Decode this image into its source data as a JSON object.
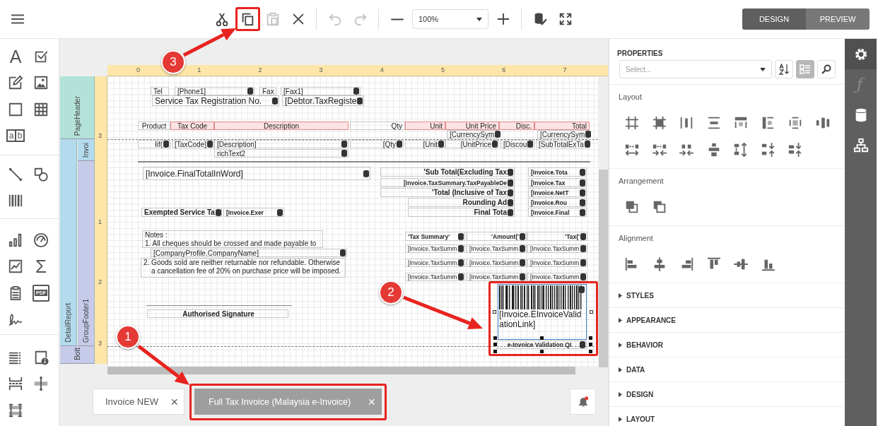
{
  "toolbar": {
    "tools": [
      {
        "kind": "cut",
        "disabled": false
      },
      {
        "kind": "copy",
        "disabled": false
      },
      {
        "kind": "paste",
        "disabled": true
      },
      {
        "kind": "delete",
        "disabled": false
      },
      {
        "kind": "undo",
        "disabled": true
      },
      {
        "kind": "redo",
        "disabled": true
      },
      {
        "kind": "zoom-out",
        "disabled": false
      },
      {
        "kind": "zoom-field",
        "value": "100%"
      },
      {
        "kind": "zoom-in",
        "disabled": false
      },
      {
        "kind": "validate",
        "disabled": false
      },
      {
        "kind": "fullscreen",
        "disabled": false
      }
    ],
    "modes": [
      {
        "label": "DESIGN",
        "selected": true
      },
      {
        "label": "PREVIEW",
        "selected": false
      }
    ]
  },
  "toolbox": [
    [
      {
        "kind": "label",
        "glyph": "A"
      },
      {
        "kind": "checkbox"
      },
      {
        "kind": "edit"
      },
      {
        "kind": "picture"
      },
      {
        "kind": "panel"
      },
      {
        "kind": "table"
      },
      {
        "kind": "character-comb",
        "glyphs": [
          "a",
          "b"
        ]
      }
    ],
    [
      {
        "kind": "line"
      },
      {
        "kind": "shape"
      },
      {
        "kind": "barcode"
      }
    ],
    [
      {
        "kind": "chart"
      },
      {
        "kind": "gauge"
      },
      {
        "kind": "sparkline"
      },
      {
        "kind": "summary",
        "glyph": "Σ"
      },
      {
        "kind": "clipboard"
      },
      {
        "kind": "pdf",
        "glyph": "PDF"
      },
      {
        "kind": "signature"
      }
    ],
    [
      {
        "kind": "toc"
      },
      {
        "kind": "page-info"
      },
      {
        "kind": "page-break"
      },
      {
        "kind": "cross-band-line"
      },
      {
        "kind": "cross-band-box"
      }
    ]
  ],
  "report": {
    "ruler": [
      "0",
      "1",
      "2",
      "3",
      "4",
      "5",
      "6",
      "7"
    ],
    "side_ruler": [
      "3",
      "1",
      "2",
      "3"
    ],
    "bands": [
      {
        "label": "PageHeader",
        "color": "#b3e2d9"
      },
      {
        "label": "DetailReport",
        "color": "#b3dbed"
      },
      {
        "label": "Invoi",
        "color": "#b3dbed"
      },
      {
        "label": "GroupFooter1",
        "color": "#c6cbe9"
      },
      {
        "label": "Bott",
        "color": "#c6cbe9"
      }
    ],
    "controls": [
      {
        "kind": "control",
        "text": "Tel",
        "bound": false
      },
      {
        "kind": "control",
        "text": "[Phone1]",
        "bound": true
      },
      {
        "kind": "control",
        "text": "Fax",
        "bound": false
      },
      {
        "kind": "control",
        "text": "[Fax1]",
        "bound": true
      },
      {
        "kind": "control",
        "text": "Service Tax Registration No.",
        "bound": true
      },
      {
        "kind": "control",
        "text": "[Debtor.TaxRegiste",
        "bound": true
      },
      {
        "kind": "column-header",
        "text": "Product",
        "warning": false
      },
      {
        "kind": "column-header",
        "text": "Tax Code",
        "warning": true
      },
      {
        "kind": "column-header",
        "text": "Description",
        "warning": true
      },
      {
        "kind": "column-header",
        "text": "Qty",
        "warning": false
      },
      {
        "kind": "column-header",
        "text": "Unit",
        "warning": true
      },
      {
        "kind": "column-header",
        "text": "Unit Price",
        "warning": true
      },
      {
        "kind": "column-header",
        "text": "Disc.",
        "warning": true
      },
      {
        "kind": "column-header",
        "text": "Total",
        "warning": true
      },
      {
        "kind": "control",
        "text": "[CurrencySym",
        "bound": true
      },
      {
        "kind": "control",
        "text": "[CurrencySym",
        "bound": true
      },
      {
        "kind": "control",
        "text": "Iif(",
        "bound": true
      },
      {
        "kind": "control",
        "text": "[TaxCode]",
        "bound": true
      },
      {
        "kind": "control",
        "text": "[Description]",
        "bound": true
      },
      {
        "kind": "control",
        "text": "[Qty",
        "bound": true
      },
      {
        "kind": "control",
        "text": "[Unit",
        "bound": true
      },
      {
        "kind": "control",
        "text": "[UnitPrice",
        "bound": true
      },
      {
        "kind": "control",
        "text": "[Discou",
        "bound": true
      },
      {
        "kind": "control",
        "text": "[SubTotalExTa",
        "bound": true
      },
      {
        "kind": "control",
        "text": "richText2",
        "bound": true
      },
      {
        "kind": "control",
        "text": "[Invoice.FinalTotalInWord]",
        "bound": true
      },
      {
        "kind": "control",
        "text": "'Sub Total(Excluding Tax",
        "bound": true
      },
      {
        "kind": "control",
        "text": "[Invoice.Tota",
        "bound": true
      },
      {
        "kind": "control",
        "text": "[Invoice.TaxSummary.TaxPayableDe",
        "bound": true
      },
      {
        "kind": "control",
        "text": "[Invoice.Tax",
        "bound": true
      },
      {
        "kind": "control",
        "text": "'Total (Inclusive of Tax",
        "bound": true
      },
      {
        "kind": "control",
        "text": "[Invoice.NetT",
        "bound": true
      },
      {
        "kind": "control",
        "text": "Rounding Ad",
        "bound": true
      },
      {
        "kind": "control",
        "text": "[Invoice.Rou",
        "bound": true
      },
      {
        "kind": "control",
        "text": "Exempted Service Ta",
        "bound": true
      },
      {
        "kind": "control",
        "text": "[Invoice.Exer",
        "bound": true
      },
      {
        "kind": "control",
        "text": "Final Tota",
        "bound": true
      },
      {
        "kind": "control",
        "text": "[Invoice.Final",
        "bound": true
      },
      {
        "kind": "control",
        "text": "Notes :\n1. All cheques should be crossed and made payable to",
        "bound": false
      },
      {
        "kind": "control",
        "text": "[CompanyProfile.CompanyName]",
        "bound": true
      },
      {
        "kind": "control",
        "text": "2. Goods sold are neither returnable nor refundable. Otherwise\n    a cancellation fee of 20% on purchase price will be imposed.",
        "bound": false
      },
      {
        "kind": "control",
        "text": "'Tax Summary'",
        "bound": true
      },
      {
        "kind": "control",
        "text": "'Amount('",
        "bound": true
      },
      {
        "kind": "control",
        "text": "'Tax('",
        "bound": true
      },
      {
        "kind": "control",
        "text": "[Invoice.TaxSumm",
        "bound": true
      },
      {
        "kind": "control",
        "text": "[Invoice.TaxSumm",
        "bound": true
      },
      {
        "kind": "control",
        "text": "[Invoice.TaxSumm",
        "bound": true
      },
      {
        "kind": "control",
        "text": "[Invoice.TaxSumm",
        "bound": true
      },
      {
        "kind": "control",
        "text": "[Invoice.TaxSumm",
        "bound": true
      },
      {
        "kind": "control",
        "text": "[Invoice.TaxSumm",
        "bound": true
      },
      {
        "kind": "control",
        "text": "[Invoice.TaxSumm",
        "bound": true
      },
      {
        "kind": "control",
        "text": "[Invoice.TaxSumm",
        "bound": true
      },
      {
        "kind": "control",
        "text": "[Invoice.TaxSumm",
        "bound": true
      },
      {
        "kind": "control",
        "text": "Authorised Signature",
        "bound": false
      },
      {
        "kind": "barcode",
        "text": "[Invoice.EInvoiceValidationLink]",
        "bound": true
      },
      {
        "kind": "control",
        "text": "e-Invoice Validation QI",
        "bound": true
      }
    ]
  },
  "document_tabs": [
    {
      "title": "Invoice NEW",
      "close": "×",
      "selected": false
    },
    {
      "title": "Full Tax Invoice (Malaysia e-Invoice)",
      "close": "×",
      "selected": true
    }
  ],
  "properties": {
    "title": "PROPERTIES",
    "select_placeholder": "Select...",
    "view_buttons": [
      {
        "kind": "sort",
        "selected": false
      },
      {
        "kind": "categories",
        "selected": true
      }
    ],
    "sections": [
      {
        "title": "Layout"
      },
      {
        "title": "Arrangement"
      },
      {
        "title": "Alignment"
      }
    ],
    "categories": [
      {
        "title": "STYLES"
      },
      {
        "title": "APPEARANCE"
      },
      {
        "title": "BEHAVIOR"
      },
      {
        "title": "DATA"
      },
      {
        "title": "DESIGN"
      },
      {
        "title": "LAYOUT"
      }
    ]
  },
  "sidebar_tabs": [
    {
      "kind": "properties",
      "selected": true
    },
    {
      "kind": "expressions",
      "glyph": "ƒ",
      "selected": false
    },
    {
      "kind": "data-source",
      "selected": false
    },
    {
      "kind": "report-explorer",
      "selected": false
    }
  ],
  "annotations": {
    "steps": [
      {
        "number": "1"
      },
      {
        "number": "2"
      },
      {
        "number": "3"
      }
    ]
  }
}
